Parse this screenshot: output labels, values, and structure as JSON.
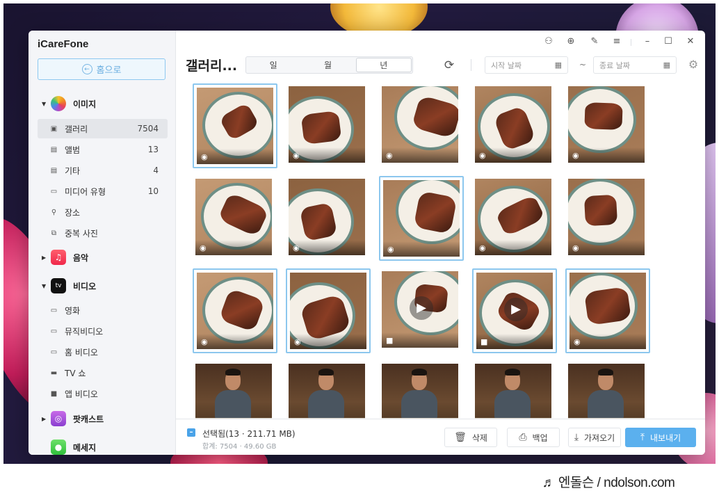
{
  "app": {
    "title": "iCareFone",
    "home_label": "홈으로"
  },
  "sidebar": {
    "groups": [
      {
        "label": "이미지",
        "icon": "photos-icon",
        "items": [
          {
            "label": "갤러리",
            "count": "7504",
            "icon": "gallery-icon"
          },
          {
            "label": "앨범",
            "count": "13",
            "icon": "album-icon"
          },
          {
            "label": "기타",
            "count": "4",
            "icon": "other-icon"
          },
          {
            "label": "미디어 유형",
            "count": "10",
            "icon": "media-type-icon"
          },
          {
            "label": "장소",
            "count": "",
            "icon": "location-icon"
          },
          {
            "label": "중복 사진",
            "count": "",
            "icon": "duplicate-icon"
          }
        ]
      },
      {
        "label": "음악",
        "icon": "music-icon",
        "items": []
      },
      {
        "label": "비디오",
        "icon": "tv-app-icon",
        "items": [
          {
            "label": "영화",
            "icon": "movie-icon"
          },
          {
            "label": "뮤직비디오",
            "icon": "music-video-icon"
          },
          {
            "label": "홈 비디오",
            "icon": "home-video-icon"
          },
          {
            "label": "TV 쇼",
            "icon": "tv-show-icon"
          },
          {
            "label": "앱 비디오",
            "icon": "app-video-icon"
          }
        ]
      },
      {
        "label": "팟캐스트",
        "icon": "podcast-icon",
        "items": []
      },
      {
        "label": "메세지",
        "icon": "messages-icon",
        "items": []
      }
    ],
    "active_item": "갤러리"
  },
  "toolbar": {
    "title": "갤러리...",
    "segments": [
      "일",
      "월",
      "년"
    ],
    "selected_segment": "년",
    "start_date_placeholder": "시작 날짜",
    "end_date_placeholder": "종료 날짜",
    "range_separator": "~"
  },
  "grid": {
    "tiles": [
      {
        "type": "photo",
        "selected": true
      },
      {
        "type": "photo",
        "selected": false
      },
      {
        "type": "photo",
        "selected": false
      },
      {
        "type": "photo",
        "selected": false
      },
      {
        "type": "photo",
        "selected": false
      },
      {
        "type": "photo",
        "selected": false
      },
      {
        "type": "photo",
        "selected": false
      },
      {
        "type": "photo",
        "selected": true
      },
      {
        "type": "photo",
        "selected": false
      },
      {
        "type": "photo",
        "selected": false
      },
      {
        "type": "photo",
        "selected": true
      },
      {
        "type": "photo",
        "selected": true
      },
      {
        "type": "video",
        "selected": false
      },
      {
        "type": "video",
        "selected": true
      },
      {
        "type": "photo",
        "selected": true
      },
      {
        "type": "person",
        "selected": false
      },
      {
        "type": "person",
        "selected": false
      },
      {
        "type": "person",
        "selected": false
      },
      {
        "type": "person",
        "selected": false
      },
      {
        "type": "person",
        "selected": false
      }
    ]
  },
  "footer": {
    "selected_text": "선택됨(13 · 211.71 MB)",
    "total_text": "합계: 7504 · 49.60 GB",
    "delete_label": "삭제",
    "backup_label": "백업",
    "import_label": "가져오기",
    "export_label": "내보내기"
  },
  "watermark": "♬ 엔돌슨 / ndolson.com",
  "colors": {
    "accent": "#5bb0ee",
    "selection_border": "#8cc7ee",
    "sidebar_bg": "#f4f5f8"
  }
}
